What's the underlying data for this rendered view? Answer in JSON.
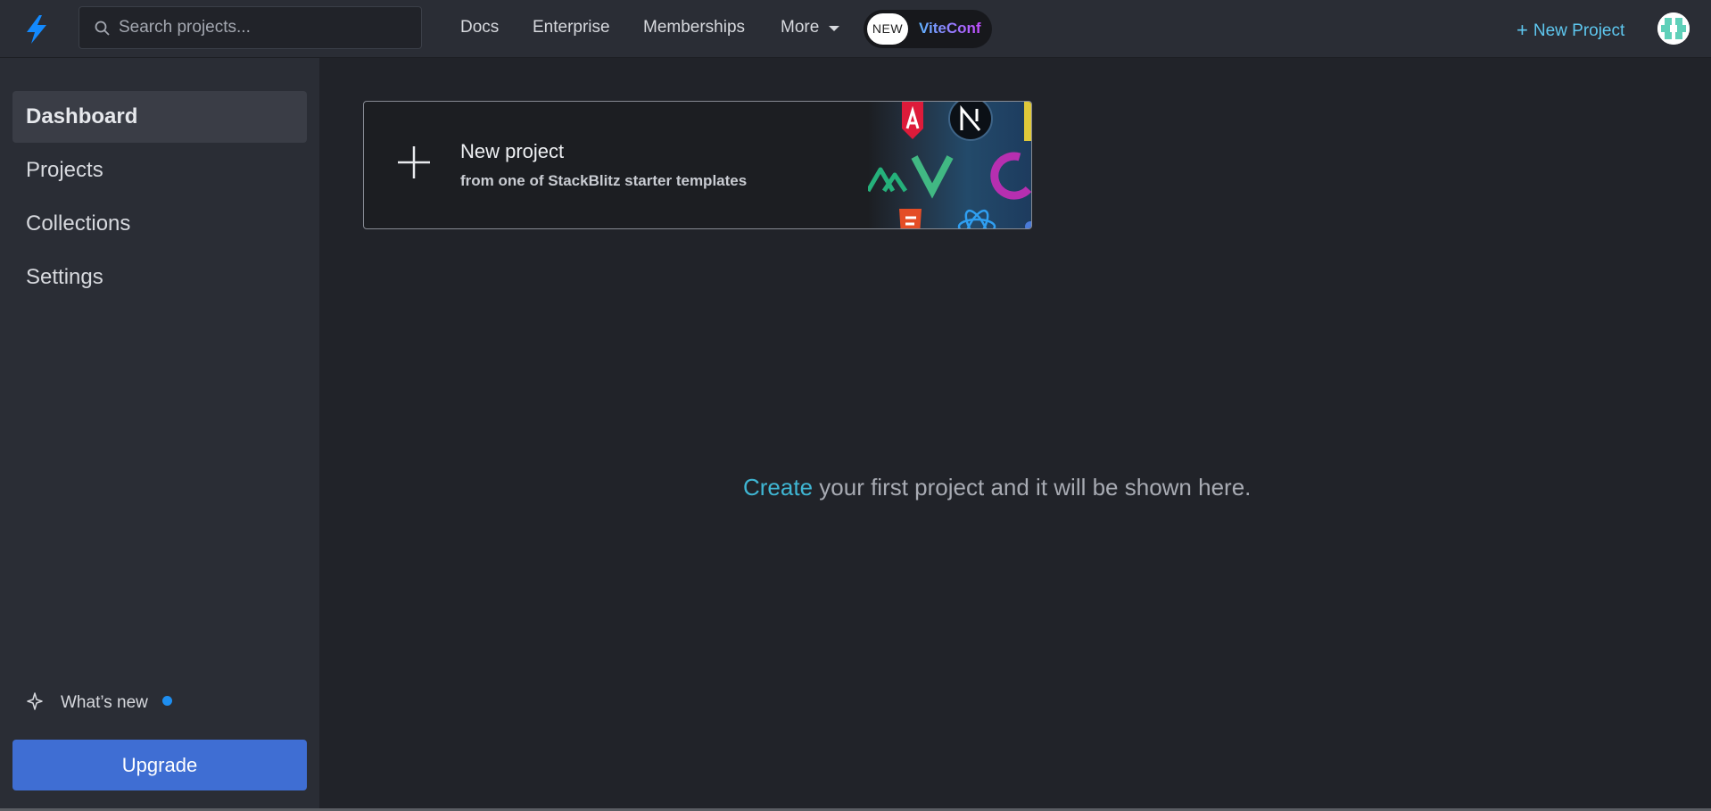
{
  "header": {
    "search_placeholder": "Search projects...",
    "nav": {
      "docs": "Docs",
      "enterprise": "Enterprise",
      "memberships": "Memberships",
      "more": "More"
    },
    "promo": {
      "badge": "NEW",
      "label": "ViteConf"
    },
    "new_project_plus": "+",
    "new_project_label": "New Project",
    "icons": {
      "logo": "lightning-bolt-icon",
      "search": "search-icon",
      "more_caret": "caret-down-icon",
      "avatar": "user-avatar"
    }
  },
  "sidebar": {
    "items": [
      {
        "label": "Dashboard",
        "active": true
      },
      {
        "label": "Projects",
        "active": false
      },
      {
        "label": "Collections",
        "active": false
      },
      {
        "label": "Settings",
        "active": false
      }
    ],
    "whats_new": "What’s new",
    "upgrade": "Upgrade"
  },
  "main": {
    "new_project_card": {
      "plus": "+",
      "title": "New project",
      "subtitle": "from one of StackBlitz starter templates",
      "art_icons": [
        "angular-icon",
        "nextjs-icon",
        "nuxt-icon",
        "vue-icon",
        "redux-icon",
        "html5-icon",
        "react-icon"
      ]
    },
    "empty_state": {
      "link": "Create",
      "text": " your first project and it will be shown here."
    }
  },
  "colors": {
    "accent": "#5ec7ef",
    "upgrade": "#3f6ed3",
    "background": "#212329",
    "sidebar": "#2a2d35"
  }
}
